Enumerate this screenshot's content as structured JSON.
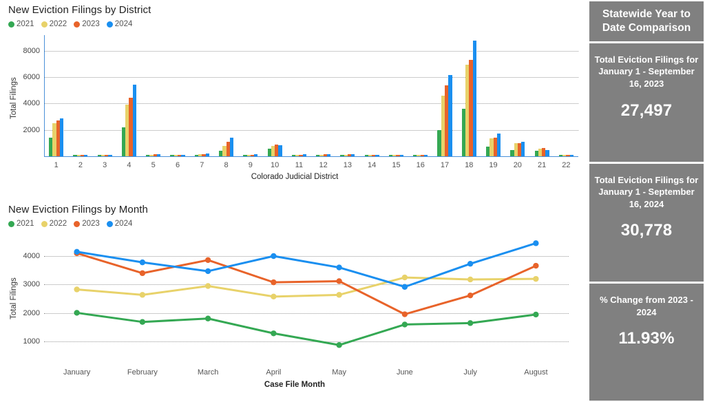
{
  "district_chart": {
    "title": "New Eviction Filings by District",
    "xlabel": "Colorado Judicial District",
    "ylabel": "Total Filings"
  },
  "month_chart": {
    "title": "New Eviction Filings by Month",
    "xlabel": "Case File Month",
    "ylabel": "Total Filings"
  },
  "legend": [
    {
      "label": "2021",
      "color": "#34a853"
    },
    {
      "label": "2022",
      "color": "#e8d26a"
    },
    {
      "label": "2023",
      "color": "#e8632a"
    },
    {
      "label": "2024",
      "color": "#1a8ff0"
    }
  ],
  "sidebar": {
    "header": "Statewide Year to Date Comparison",
    "cards": [
      {
        "label": "Total Eviction Filings for January 1 - September 16, 2023",
        "value": "27,497"
      },
      {
        "label": "Total Eviction Filings for January 1 - September 16, 2024",
        "value": "30,778"
      },
      {
        "label": "% Change from 2023 - 2024",
        "value": "11.93%"
      }
    ]
  },
  "chart_data": [
    {
      "type": "bar",
      "title": "New Eviction Filings by District",
      "xlabel": "Colorado Judicial District",
      "ylabel": "Total Filings",
      "categories": [
        "1",
        "2",
        "3",
        "4",
        "5",
        "6",
        "7",
        "8",
        "9",
        "10",
        "11",
        "12",
        "13",
        "14",
        "15",
        "16",
        "17",
        "18",
        "19",
        "20",
        "21",
        "22"
      ],
      "ylim": [
        0,
        9200
      ],
      "yticks": [
        2000,
        4000,
        6000,
        8000
      ],
      "grid": true,
      "legend_position": "top-left",
      "series": [
        {
          "name": "2021",
          "color": "#34a853",
          "values": [
            1400,
            40,
            30,
            2200,
            90,
            70,
            110,
            420,
            60,
            600,
            70,
            80,
            80,
            40,
            30,
            50,
            2000,
            3600,
            750,
            480,
            400,
            30
          ]
        },
        {
          "name": "2022",
          "color": "#e8d26a",
          "values": [
            2500,
            60,
            50,
            3900,
            130,
            100,
            150,
            800,
            90,
            800,
            110,
            120,
            120,
            60,
            50,
            80,
            4600,
            6950,
            1350,
            1000,
            560,
            50
          ]
        },
        {
          "name": "2023",
          "color": "#e8632a",
          "values": [
            2700,
            70,
            60,
            4450,
            150,
            110,
            170,
            1100,
            110,
            870,
            130,
            140,
            140,
            70,
            60,
            100,
            5400,
            7300,
            1400,
            1000,
            620,
            70
          ]
        },
        {
          "name": "2024",
          "color": "#1a8ff0",
          "values": [
            2900,
            90,
            80,
            5450,
            180,
            130,
            190,
            1400,
            140,
            830,
            150,
            160,
            160,
            90,
            80,
            120,
            6150,
            8800,
            1700,
            1100,
            450,
            90
          ]
        }
      ]
    },
    {
      "type": "line",
      "title": "New Eviction Filings by Month",
      "xlabel": "Case File Month",
      "ylabel": "Total Filings",
      "categories": [
        "January",
        "February",
        "March",
        "April",
        "May",
        "June",
        "July",
        "August"
      ],
      "ylim": [
        500,
        4700
      ],
      "yticks": [
        1000,
        2000,
        3000,
        4000
      ],
      "grid": true,
      "legend_position": "top-left",
      "series": [
        {
          "name": "2021",
          "color": "#34a853",
          "values": [
            2010,
            1690,
            1810,
            1290,
            880,
            1600,
            1650,
            1950
          ]
        },
        {
          "name": "2022",
          "color": "#e8d26a",
          "values": [
            2830,
            2640,
            2950,
            2580,
            2640,
            3250,
            3180,
            3200
          ]
        },
        {
          "name": "2023",
          "color": "#e8632a",
          "values": [
            4100,
            3400,
            3860,
            3080,
            3120,
            1960,
            2620,
            3660
          ]
        },
        {
          "name": "2024",
          "color": "#1a8ff0",
          "values": [
            4150,
            3780,
            3470,
            4000,
            3600,
            2920,
            3730,
            4450
          ]
        }
      ]
    }
  ]
}
